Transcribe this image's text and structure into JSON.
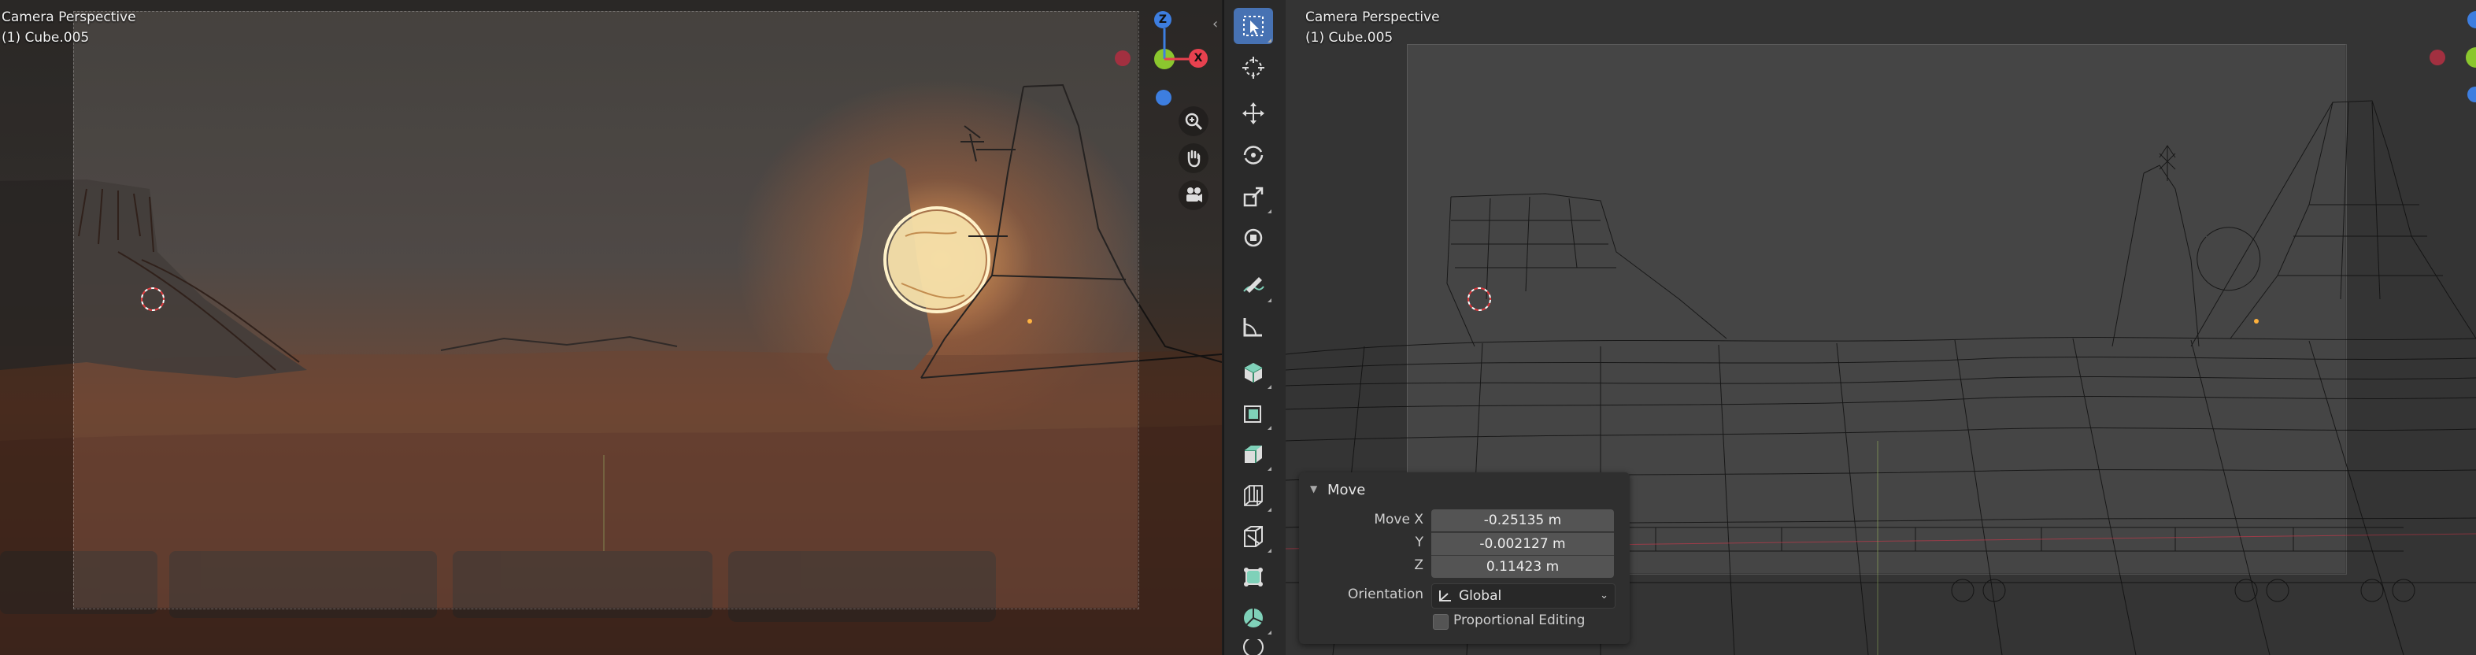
{
  "left_viewport": {
    "view_name": "Camera Perspective",
    "object_name": "(1) Cube.005"
  },
  "right_viewport": {
    "view_name": "Camera Perspective",
    "object_name": "(1) Cube.005"
  },
  "gizmo": {
    "z_label": "Z",
    "x_label": "X",
    "colors": {
      "x": "#e8414f",
      "y": "#8bc72e",
      "z": "#3d7ee0",
      "x_neg": "#a23040"
    }
  },
  "toolbar": {
    "active_tool": "select-box",
    "tools": [
      "select-box-icon",
      "cursor-icon",
      "move-icon",
      "rotate-icon",
      "scale-icon",
      "transform-icon",
      "annotate-icon",
      "measure-icon",
      "add-cube-icon",
      "extrude-icon",
      "inset-icon",
      "bevel-icon",
      "loop-cut-icon",
      "knife-icon",
      "poly-build-icon",
      "spin-icon"
    ],
    "accent": "#4772b3"
  },
  "operator_panel": {
    "title": "Move",
    "move_x_label": "Move X",
    "move_x_value": "-0.25135 m",
    "y_label": "Y",
    "y_value": "-0.002127 m",
    "z_label": "Z",
    "z_value": "0.11423 m",
    "orientation_label": "Orientation",
    "orientation_value": "Global",
    "proportional_editing_label": "Proportional Editing",
    "proportional_editing_checked": false
  }
}
